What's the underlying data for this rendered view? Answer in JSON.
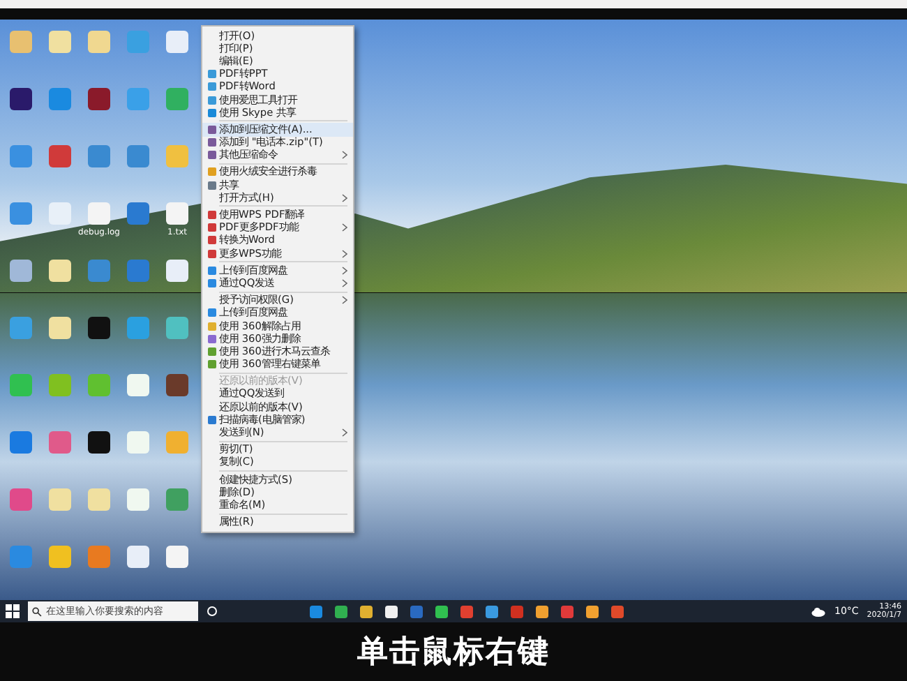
{
  "desktop": {
    "icon_rows": [
      [
        {
          "color": "#e8c070"
        },
        {
          "color": "#f0e0a0"
        },
        {
          "color": "#f0d890"
        },
        {
          "color": "#3aa0e0"
        },
        {
          "color": "#e8eef8"
        }
      ],
      [
        {
          "color": "#2a1a6a"
        },
        {
          "color": "#1a8ae0"
        },
        {
          "color": "#8a1a2a"
        },
        {
          "color": "#3aa0e8"
        },
        {
          "color": "#30b060"
        }
      ],
      [
        {
          "color": "#3a90e0"
        },
        {
          "color": "#d03a3a"
        },
        {
          "color": "#3a8ad0"
        },
        {
          "color": "#3a8ad0"
        },
        {
          "color": "#f0c040"
        }
      ],
      [
        {
          "color": "#3a90e0"
        },
        {
          "color": "#e8f0f8"
        },
        {
          "color": "#f4f4f4",
          "label": "debug.log"
        },
        {
          "color": "#2a7ad0"
        },
        {
          "color": "#f4f4f4",
          "label": "1.txt"
        }
      ],
      [
        {
          "color": "#a0b8d8"
        },
        {
          "color": "#f0e0a0"
        },
        {
          "color": "#3a8ad0"
        },
        {
          "color": "#2a7ad0"
        },
        {
          "color": "#e8eef8"
        }
      ],
      [
        {
          "color": "#3aa0e0"
        },
        {
          "color": "#f0e0a0"
        },
        {
          "color": "#111111"
        },
        {
          "color": "#2aa0e0"
        },
        {
          "color": "#50c0c0"
        }
      ],
      [
        {
          "color": "#30c050"
        },
        {
          "color": "#80c020"
        },
        {
          "color": "#60c030"
        },
        {
          "color": "#f0f8f0"
        },
        {
          "color": "#6a3a2a"
        }
      ],
      [
        {
          "color": "#1a7ae0"
        },
        {
          "color": "#e05a8a"
        },
        {
          "color": "#111111"
        },
        {
          "color": "#f0f8f0"
        },
        {
          "color": "#f0b030"
        }
      ],
      [
        {
          "color": "#e04a8a"
        },
        {
          "color": "#f0e0a0"
        },
        {
          "color": "#f0e0a0"
        },
        {
          "color": "#f0f8f0"
        },
        {
          "color": "#40a060"
        }
      ],
      [
        {
          "color": "#2a8ae0"
        },
        {
          "color": "#f0c020"
        },
        {
          "color": "#e87a20"
        },
        {
          "color": "#e8eef8"
        },
        {
          "color": "#f4f4f4"
        }
      ]
    ]
  },
  "context_menu": {
    "items": [
      {
        "kind": "item",
        "label": "打开(O)"
      },
      {
        "kind": "item",
        "label": "打印(P)"
      },
      {
        "kind": "item",
        "label": "编辑(E)"
      },
      {
        "kind": "item",
        "label": "PDF转PPT",
        "color": "#3a9ad8"
      },
      {
        "kind": "item",
        "label": "PDF转Word",
        "color": "#3a9ad8"
      },
      {
        "kind": "item",
        "label": "使用爱思工具打开",
        "color": "#3a9ad8"
      },
      {
        "kind": "item",
        "label": "使用 Skype 共享",
        "color": "#1a8ad8"
      },
      {
        "kind": "separator"
      },
      {
        "kind": "item",
        "label": "添加到压缩文件(A)...",
        "color": "#7a5a9a",
        "selected": true
      },
      {
        "kind": "item",
        "label": "添加到 \"电话本.zip\"(T)",
        "color": "#7a5a9a"
      },
      {
        "kind": "item",
        "label": "其他压缩命令",
        "color": "#7a5a9a",
        "submenu": true
      },
      {
        "kind": "separator"
      },
      {
        "kind": "item",
        "label": "使用火绒安全进行杀毒",
        "color": "#e0a020"
      },
      {
        "kind": "item",
        "label": "共享",
        "color": "#6a7a8a"
      },
      {
        "kind": "item",
        "label": "打开方式(H)",
        "submenu": true
      },
      {
        "kind": "separator"
      },
      {
        "kind": "item",
        "label": "使用WPS PDF翻译",
        "color": "#d03a3a"
      },
      {
        "kind": "item",
        "label": "PDF更多PDF功能",
        "color": "#d03a3a",
        "submenu": true
      },
      {
        "kind": "item",
        "label": "转换为Word",
        "color": "#d03a3a"
      },
      {
        "kind": "item",
        "label": "更多WPS功能",
        "color": "#d03a3a",
        "submenu": true
      },
      {
        "kind": "separator"
      },
      {
        "kind": "item",
        "label": "上传到百度网盘",
        "color": "#2a8ae0",
        "submenu": true
      },
      {
        "kind": "item",
        "label": "通过QQ发送",
        "color": "#2a8ae0",
        "submenu": true
      },
      {
        "kind": "separator"
      },
      {
        "kind": "item",
        "label": "授予访问权限(G)",
        "submenu": true
      },
      {
        "kind": "item",
        "label": "上传到百度网盘",
        "color": "#2a8ae0"
      },
      {
        "kind": "item",
        "label": "使用 360解除占用",
        "color": "#e0b030"
      },
      {
        "kind": "item",
        "label": "使用 360强力删除",
        "color": "#8a6ad0"
      },
      {
        "kind": "item",
        "label": "使用 360进行木马云查杀",
        "color": "#60a030"
      },
      {
        "kind": "item",
        "label": "使用 360管理右键菜单",
        "color": "#60a030"
      },
      {
        "kind": "separator"
      },
      {
        "kind": "item",
        "label": "还原以前的版本(V)",
        "disabled": true
      },
      {
        "kind": "item",
        "label": "通过QQ发送到"
      },
      {
        "kind": "item",
        "label": "还原以前的版本(V)"
      },
      {
        "kind": "item",
        "label": "扫描病毒(电脑管家)",
        "color": "#2a7ad0"
      },
      {
        "kind": "item",
        "label": "发送到(N)",
        "submenu": true
      },
      {
        "kind": "separator"
      },
      {
        "kind": "item",
        "label": "剪切(T)"
      },
      {
        "kind": "item",
        "label": "复制(C)"
      },
      {
        "kind": "separator"
      },
      {
        "kind": "item",
        "label": "创建快捷方式(S)"
      },
      {
        "kind": "item",
        "label": "删除(D)"
      },
      {
        "kind": "item",
        "label": "重命名(M)"
      },
      {
        "kind": "separator"
      },
      {
        "kind": "item",
        "label": "属性(R)"
      }
    ]
  },
  "taskbar": {
    "search": {
      "placeholder": "在这里输入你要搜索的内容"
    },
    "apps": [
      {
        "color": "#1a8ae0"
      },
      {
        "color": "#30b050"
      },
      {
        "color": "#e0b030"
      },
      {
        "color": "#f0f0f0"
      },
      {
        "color": "#2a6ac0"
      },
      {
        "color": "#30c050"
      },
      {
        "color": "#e04030"
      },
      {
        "color": "#3a9ae0"
      },
      {
        "color": "#d03020"
      },
      {
        "color": "#f0a030"
      },
      {
        "color": "#e03a3a"
      },
      {
        "color": "#f0a030"
      },
      {
        "color": "#e04a2a"
      }
    ],
    "temperature": "10°C",
    "time": "13:46",
    "date": "2020/1/7"
  },
  "caption": "单击鼠标右键"
}
